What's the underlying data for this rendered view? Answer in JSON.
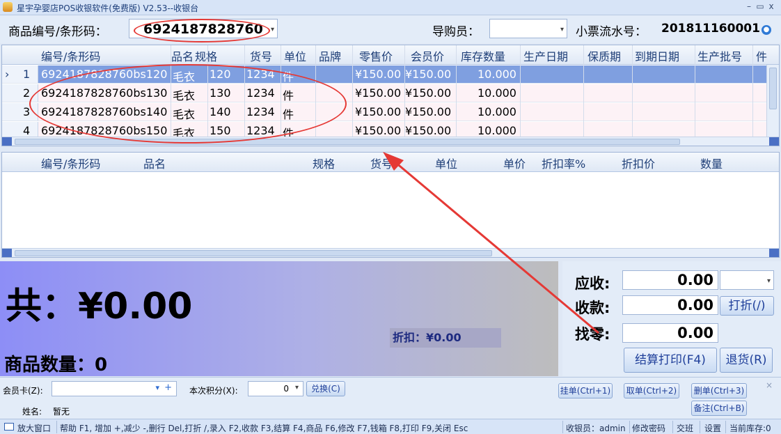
{
  "window": {
    "title": "星宇孕婴店POS收银软件(免费版) V2.53--收银台",
    "minimize": "–",
    "maximize": "▭",
    "close": "x"
  },
  "topbar": {
    "barcode_label": "商品编号/条形码：",
    "barcode_value": "6924187828760",
    "guide_label": "导购员：",
    "guide_value": "",
    "receipt_label": "小票流水号：",
    "receipt_value": "201811160001"
  },
  "products": {
    "columns": [
      "编号/条形码",
      "品名",
      "规格",
      "货号",
      "单位",
      "品牌",
      "零售价",
      "会员价",
      "库存数量",
      "生产日期",
      "保质期",
      "到期日期",
      "生产批号",
      "件"
    ],
    "rows": [
      {
        "num": "1",
        "code": "6924187828760bs120",
        "name": "毛衣",
        "spec": "120",
        "sku": "1234",
        "unit": "件",
        "brand": "",
        "retail": "¥150.00",
        "member": "¥150.00",
        "stock": "10.000"
      },
      {
        "num": "2",
        "code": "6924187828760bs130",
        "name": "毛衣",
        "spec": "130",
        "sku": "1234",
        "unit": "件",
        "brand": "",
        "retail": "¥150.00",
        "member": "¥150.00",
        "stock": "10.000"
      },
      {
        "num": "3",
        "code": "6924187828760bs140",
        "name": "毛衣",
        "spec": "140",
        "sku": "1234",
        "unit": "件",
        "brand": "",
        "retail": "¥150.00",
        "member": "¥150.00",
        "stock": "10.000"
      },
      {
        "num": "4",
        "code": "6924187828760bs150",
        "name": "毛衣",
        "spec": "150",
        "sku": "1234",
        "unit": "件",
        "brand": "",
        "retail": "¥150.00",
        "member": "¥150.00",
        "stock": "10.000"
      }
    ],
    "row_marker": "›"
  },
  "cart": {
    "columns": [
      "编号/条形码",
      "品名",
      "规格",
      "货号",
      "单位",
      "单价",
      "折扣率%",
      "折扣价",
      "数量"
    ]
  },
  "totals": {
    "total": "共：¥0.00",
    "quantity": "商品数量：0",
    "discount": "折扣：¥0.00"
  },
  "payment": {
    "receivable_label": "应收:",
    "receivable": "0.00",
    "received_label": "收款:",
    "received": "0.00",
    "change_label": "找零:",
    "change": "0.00",
    "discount_button": "打折(/)",
    "checkout_button": "结算打印(F4)",
    "return_button": "退货(R)"
  },
  "member": {
    "card_label": "会员卡(Z):",
    "points_label": "本次积分(X):",
    "points_value": "0",
    "redeem_button": "兑换(C)",
    "name_label": "姓名:",
    "name_value": "暂无",
    "hold_button": "挂单(Ctrl+1)",
    "retrieve_button": "取单(Ctrl+2)",
    "delete_button": "删单(Ctrl+3)",
    "note_button": "备注(Ctrl+B)"
  },
  "status": {
    "enlarge": "放大窗口",
    "help": "帮助 F1, 增加 +,减少 -,删行 Del,打折 /,录入 F2,收款 F3,结算 F4,商品 F6,修改 F7,钱箱 F8,打印 F9,关闭 Esc",
    "cashier": "收银员：admin",
    "change_password": "修改密码",
    "handover": "交班",
    "settings": "设置",
    "current_stock": "当前库存:0"
  },
  "colors": {
    "annotation": "#e53935",
    "selected_row": "#7f9fe0"
  }
}
